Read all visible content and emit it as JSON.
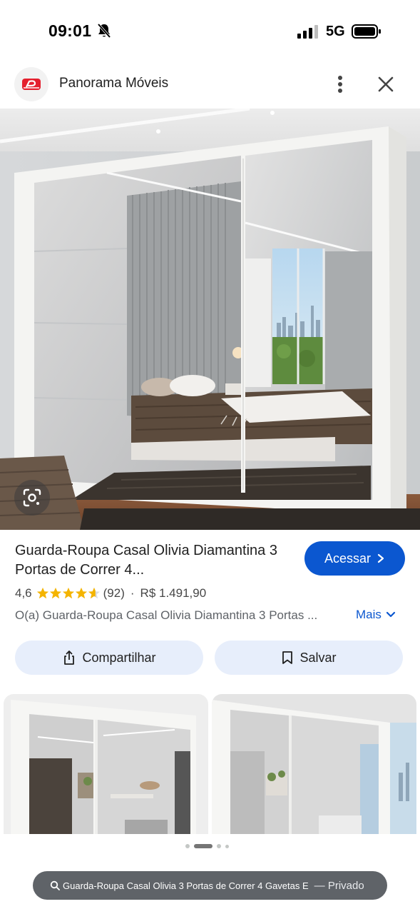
{
  "status_bar": {
    "time": "09:01",
    "network": "5G"
  },
  "header": {
    "site_name": "Panorama Móveis"
  },
  "product": {
    "title": "Guarda-Roupa Casal Olivia Diamantina 3 Portas de Correr 4...",
    "visit_label": "Acessar",
    "rating": "4,6",
    "review_count": "(92)",
    "separator": "·",
    "price": "R$ 1.491,90",
    "description": "O(a) Guarda-Roupa Casal Olivia Diamantina 3 Portas ...",
    "more_label": "Mais",
    "share_label": "Compartilhar",
    "save_label": "Salvar"
  },
  "search_pill": {
    "query": "Guarda-Roupa Casal Olivia 3 Portas de Correr 4 Gavetas E",
    "private_label": "— Privado"
  },
  "colors": {
    "accent": "#0b57d0",
    "chip_bg": "#e7eefb",
    "star": "#f4b400",
    "logo_red": "#e4202e"
  },
  "icons": [
    "bell-off-icon",
    "signal-icon",
    "battery-icon",
    "more-vert-icon",
    "close-icon",
    "lens-icon",
    "chevron-right-icon",
    "star-icon",
    "chevron-down-icon",
    "share-icon",
    "bookmark-icon",
    "search-icon"
  ]
}
